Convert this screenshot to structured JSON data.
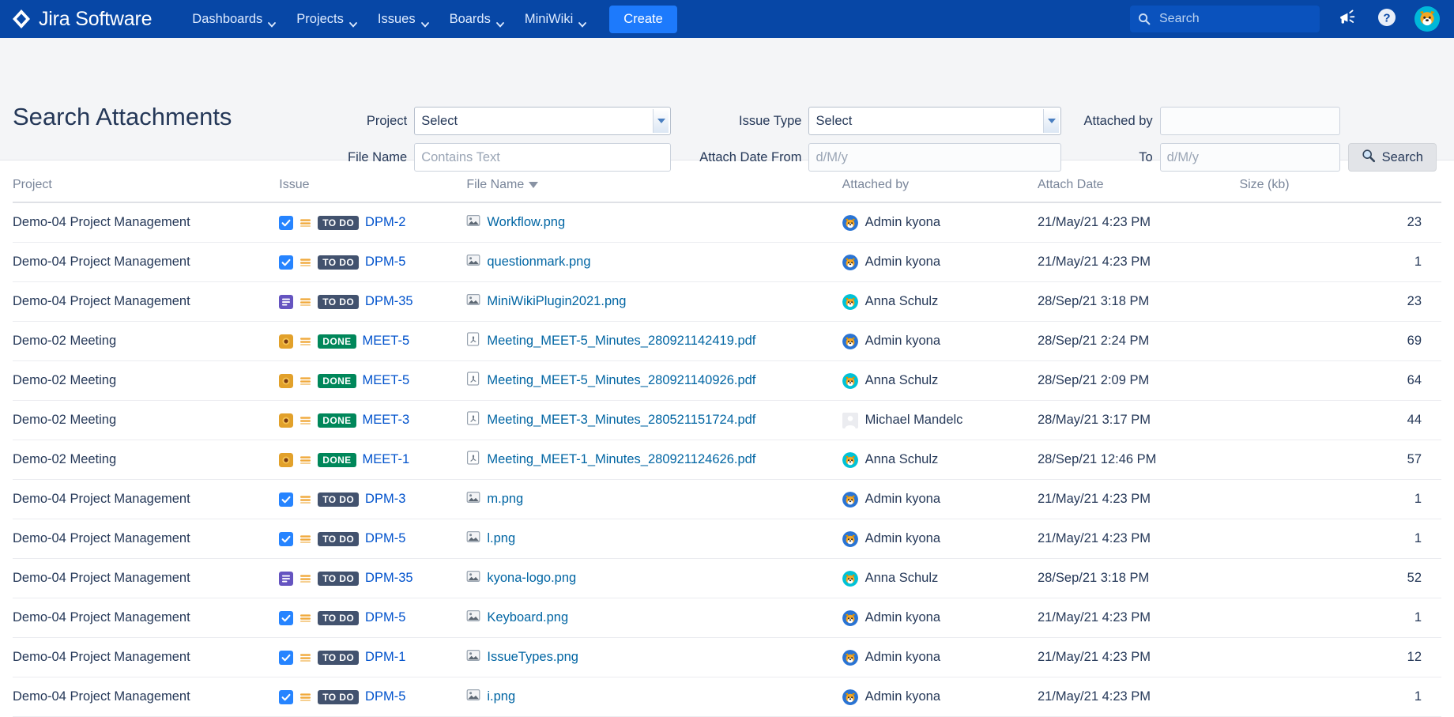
{
  "nav": {
    "brand": "Jira Software",
    "brand_icon": "jira-diamond-logo",
    "items": [
      {
        "label": "Dashboards",
        "icon": "chevron-down-icon"
      },
      {
        "label": "Projects",
        "icon": "chevron-down-icon"
      },
      {
        "label": "Issues",
        "icon": "chevron-down-icon"
      },
      {
        "label": "Boards",
        "icon": "chevron-down-icon"
      },
      {
        "label": "MiniWiki",
        "icon": "chevron-down-icon"
      }
    ],
    "create_label": "Create",
    "search_placeholder": "Search",
    "search_value": "",
    "search_icon": "search-icon",
    "announce_icon": "megaphone-icon",
    "help_icon": "help-circle-icon",
    "avatar_icon": "user-avatar-dog",
    "colors": {
      "bar": "#0747a6",
      "create": "#1d7afc",
      "search_bg": "#0a52bd"
    }
  },
  "panel": {
    "title": "Search Attachments",
    "fields": {
      "project_label": "Project",
      "project_value": "Select",
      "issue_type_label": "Issue Type",
      "issue_type_value": "Select",
      "attached_by_label": "Attached by",
      "attached_by_value": "",
      "file_name_label": "File Name",
      "file_name_placeholder": "Contains Text",
      "file_name_value": "",
      "attach_date_from_label": "Attach Date From",
      "attach_date_from_placeholder": "d/M/y",
      "attach_date_from_value": "",
      "to_label": "To",
      "to_placeholder": "d/M/y",
      "to_value": "",
      "search_button": "Search",
      "search_button_icon": "magnifier-icon"
    }
  },
  "table": {
    "headers": {
      "project": "Project",
      "issue": "Issue",
      "file_name": "File Name",
      "attached_by": "Attached by",
      "attach_date": "Attach Date",
      "size": "Size (kb)"
    },
    "sort_column": "file_name",
    "sort_icon": "sort-descending-caret",
    "rows": [
      {
        "project": "Demo-04 Project Management",
        "type": "task",
        "priority": "medium",
        "status": "TO DO",
        "status_kind": "todo",
        "key": "DPM-2",
        "file": "Workflow.png",
        "file_kind": "image",
        "by": "Admin kyona",
        "avatar": "admin-kyona",
        "date": "21/May/21 4:23 PM",
        "size": "23"
      },
      {
        "project": "Demo-04 Project Management",
        "type": "task",
        "priority": "medium",
        "status": "TO DO",
        "status_kind": "todo",
        "key": "DPM-5",
        "file": "questionmark.png",
        "file_kind": "image",
        "by": "Admin kyona",
        "avatar": "admin-kyona",
        "date": "21/May/21 4:23 PM",
        "size": "1"
      },
      {
        "project": "Demo-04 Project Management",
        "type": "story",
        "priority": "medium",
        "status": "TO DO",
        "status_kind": "todo",
        "key": "DPM-35",
        "file": "MiniWikiPlugin2021.png",
        "file_kind": "image",
        "by": "Anna Schulz",
        "avatar": "anna-schulz",
        "date": "28/Sep/21 3:18 PM",
        "size": "23"
      },
      {
        "project": "Demo-02 Meeting",
        "type": "meeting",
        "priority": "medium",
        "status": "DONE",
        "status_kind": "done",
        "key": "MEET-5",
        "file": "Meeting_MEET-5_Minutes_280921142419.pdf",
        "file_kind": "pdf",
        "by": "Admin kyona",
        "avatar": "admin-kyona",
        "date": "28/Sep/21 2:24 PM",
        "size": "69"
      },
      {
        "project": "Demo-02 Meeting",
        "type": "meeting",
        "priority": "medium",
        "status": "DONE",
        "status_kind": "done",
        "key": "MEET-5",
        "file": "Meeting_MEET-5_Minutes_280921140926.pdf",
        "file_kind": "pdf",
        "by": "Anna Schulz",
        "avatar": "anna-schulz",
        "date": "28/Sep/21 2:09 PM",
        "size": "64"
      },
      {
        "project": "Demo-02 Meeting",
        "type": "meeting",
        "priority": "medium",
        "status": "DONE",
        "status_kind": "done",
        "key": "MEET-3",
        "file": "Meeting_MEET-3_Minutes_280521151724.pdf",
        "file_kind": "pdf",
        "by": "Michael Mandelc",
        "avatar": "default-user",
        "date": "28/May/21 3:17 PM",
        "size": "44"
      },
      {
        "project": "Demo-02 Meeting",
        "type": "meeting",
        "priority": "medium",
        "status": "DONE",
        "status_kind": "done",
        "key": "MEET-1",
        "file": "Meeting_MEET-1_Minutes_280921124626.pdf",
        "file_kind": "pdf",
        "by": "Anna Schulz",
        "avatar": "anna-schulz",
        "date": "28/Sep/21 12:46 PM",
        "size": "57"
      },
      {
        "project": "Demo-04 Project Management",
        "type": "task",
        "priority": "medium",
        "status": "TO DO",
        "status_kind": "todo",
        "key": "DPM-3",
        "file": "m.png",
        "file_kind": "image",
        "by": "Admin kyona",
        "avatar": "admin-kyona",
        "date": "21/May/21 4:23 PM",
        "size": "1"
      },
      {
        "project": "Demo-04 Project Management",
        "type": "task",
        "priority": "medium",
        "status": "TO DO",
        "status_kind": "todo",
        "key": "DPM-5",
        "file": "l.png",
        "file_kind": "image",
        "by": "Admin kyona",
        "avatar": "admin-kyona",
        "date": "21/May/21 4:23 PM",
        "size": "1"
      },
      {
        "project": "Demo-04 Project Management",
        "type": "story",
        "priority": "medium",
        "status": "TO DO",
        "status_kind": "todo",
        "key": "DPM-35",
        "file": "kyona-logo.png",
        "file_kind": "image",
        "by": "Anna Schulz",
        "avatar": "anna-schulz",
        "date": "28/Sep/21 3:18 PM",
        "size": "52"
      },
      {
        "project": "Demo-04 Project Management",
        "type": "task",
        "priority": "medium",
        "status": "TO DO",
        "status_kind": "todo",
        "key": "DPM-5",
        "file": "Keyboard.png",
        "file_kind": "image",
        "by": "Admin kyona",
        "avatar": "admin-kyona",
        "date": "21/May/21 4:23 PM",
        "size": "1"
      },
      {
        "project": "Demo-04 Project Management",
        "type": "task",
        "priority": "medium",
        "status": "TO DO",
        "status_kind": "todo",
        "key": "DPM-1",
        "file": "IssueTypes.png",
        "file_kind": "image",
        "by": "Admin kyona",
        "avatar": "admin-kyona",
        "date": "21/May/21 4:23 PM",
        "size": "12"
      },
      {
        "project": "Demo-04 Project Management",
        "type": "task",
        "priority": "medium",
        "status": "TO DO",
        "status_kind": "todo",
        "key": "DPM-5",
        "file": "i.png",
        "file_kind": "image",
        "by": "Admin kyona",
        "avatar": "admin-kyona",
        "date": "21/May/21 4:23 PM",
        "size": "1"
      }
    ]
  }
}
